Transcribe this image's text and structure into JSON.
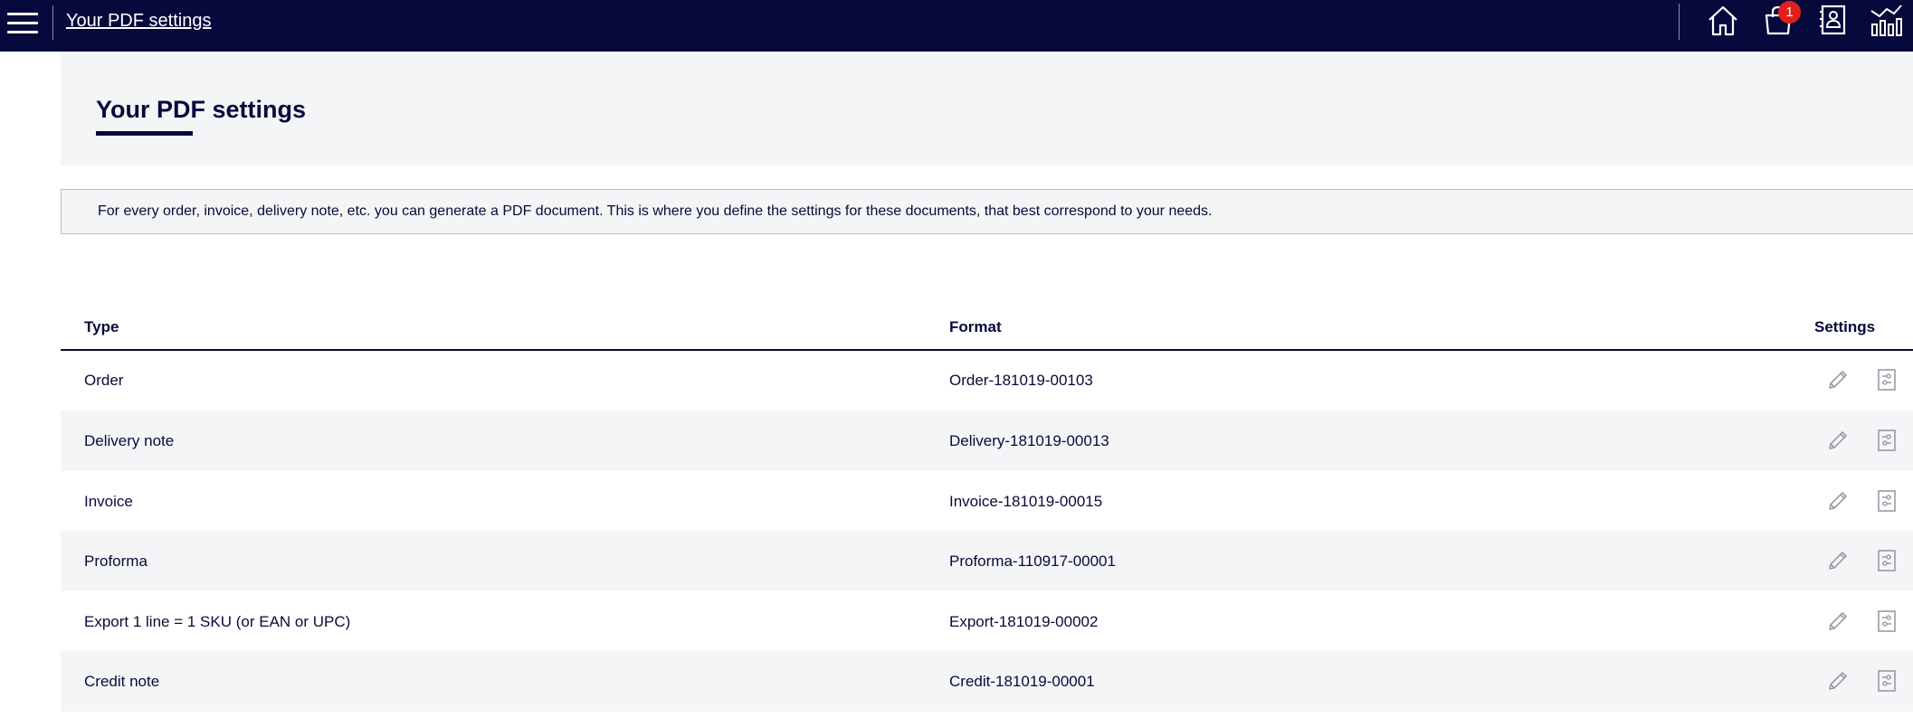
{
  "topbar": {
    "title": "Your PDF settings",
    "notifications_count": "1",
    "icons": [
      "menu-icon",
      "home-icon",
      "shopping-bag-icon",
      "contacts-icon",
      "stats-icon"
    ]
  },
  "page": {
    "title": "Your PDF settings",
    "info": "For every order, invoice, delivery note, etc. you can generate a PDF document. This is where you define the settings for these documents, that best correspond to your needs."
  },
  "table": {
    "columns": [
      "Type",
      "Format",
      "Settings"
    ],
    "rows": [
      {
        "type": "Order",
        "format": "Order-181019-00103"
      },
      {
        "type": "Delivery note",
        "format": "Delivery-181019-00013"
      },
      {
        "type": "Invoice",
        "format": "Invoice-181019-00015"
      },
      {
        "type": "Proforma",
        "format": "Proforma-110917-00001"
      },
      {
        "type": "Export 1 line = 1 SKU (or EAN or UPC)",
        "format": "Export-181019-00002"
      },
      {
        "type": "Credit note",
        "format": "Credit-181019-00001"
      }
    ],
    "row_icons": [
      "pencil-icon",
      "settings-doc-icon"
    ]
  },
  "colors": {
    "topbar": "#06093b",
    "accent": "#06093b",
    "badge": "#e0201c",
    "panel": "#f4f5f7"
  }
}
